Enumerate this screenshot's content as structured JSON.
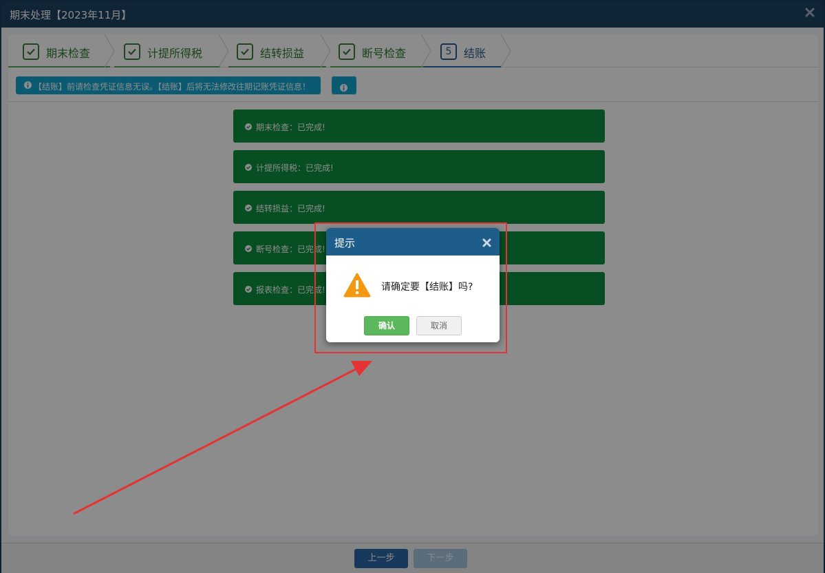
{
  "window": {
    "title": "期末处理【2023年11月】"
  },
  "steps": [
    {
      "label": "期末检查",
      "state": "done"
    },
    {
      "label": "计提所得税",
      "state": "done"
    },
    {
      "label": "结转损益",
      "state": "done"
    },
    {
      "label": "断号检查",
      "state": "done"
    },
    {
      "label": "结账",
      "state": "current",
      "number": "5"
    }
  ],
  "notice": {
    "text": "【结账】前请检查凭证信息无误。【结账】后将无法修改往期记账凭证信息！"
  },
  "status_items": [
    {
      "text": "期末检查：已完成!"
    },
    {
      "text": "计提所得税：已完成!"
    },
    {
      "text": "结转损益：已完成!"
    },
    {
      "text": "断号检查：已完成!"
    },
    {
      "text": "报表检查：已完成!"
    }
  ],
  "footer": {
    "prev_label": "上一步",
    "next_label": "下一步"
  },
  "dialog": {
    "title": "提示",
    "message": "请确定要【结账】吗?",
    "confirm_label": "确认",
    "cancel_label": "取消"
  },
  "colors": {
    "title_bar": "#1d4262",
    "step_done": "#3d7f3d",
    "step_current": "#2a5d8a",
    "notice": "#13a6cf",
    "status_green": "#0d8f3e",
    "dialog_header": "#1e5d8a",
    "confirm": "#5cb85c",
    "annotation_red": "#e53333"
  },
  "icons": {
    "close": "close-icon",
    "check": "checkmark-icon",
    "info": "info-circle-icon",
    "check_circle": "check-circle-icon",
    "warning": "warning-triangle-icon"
  }
}
